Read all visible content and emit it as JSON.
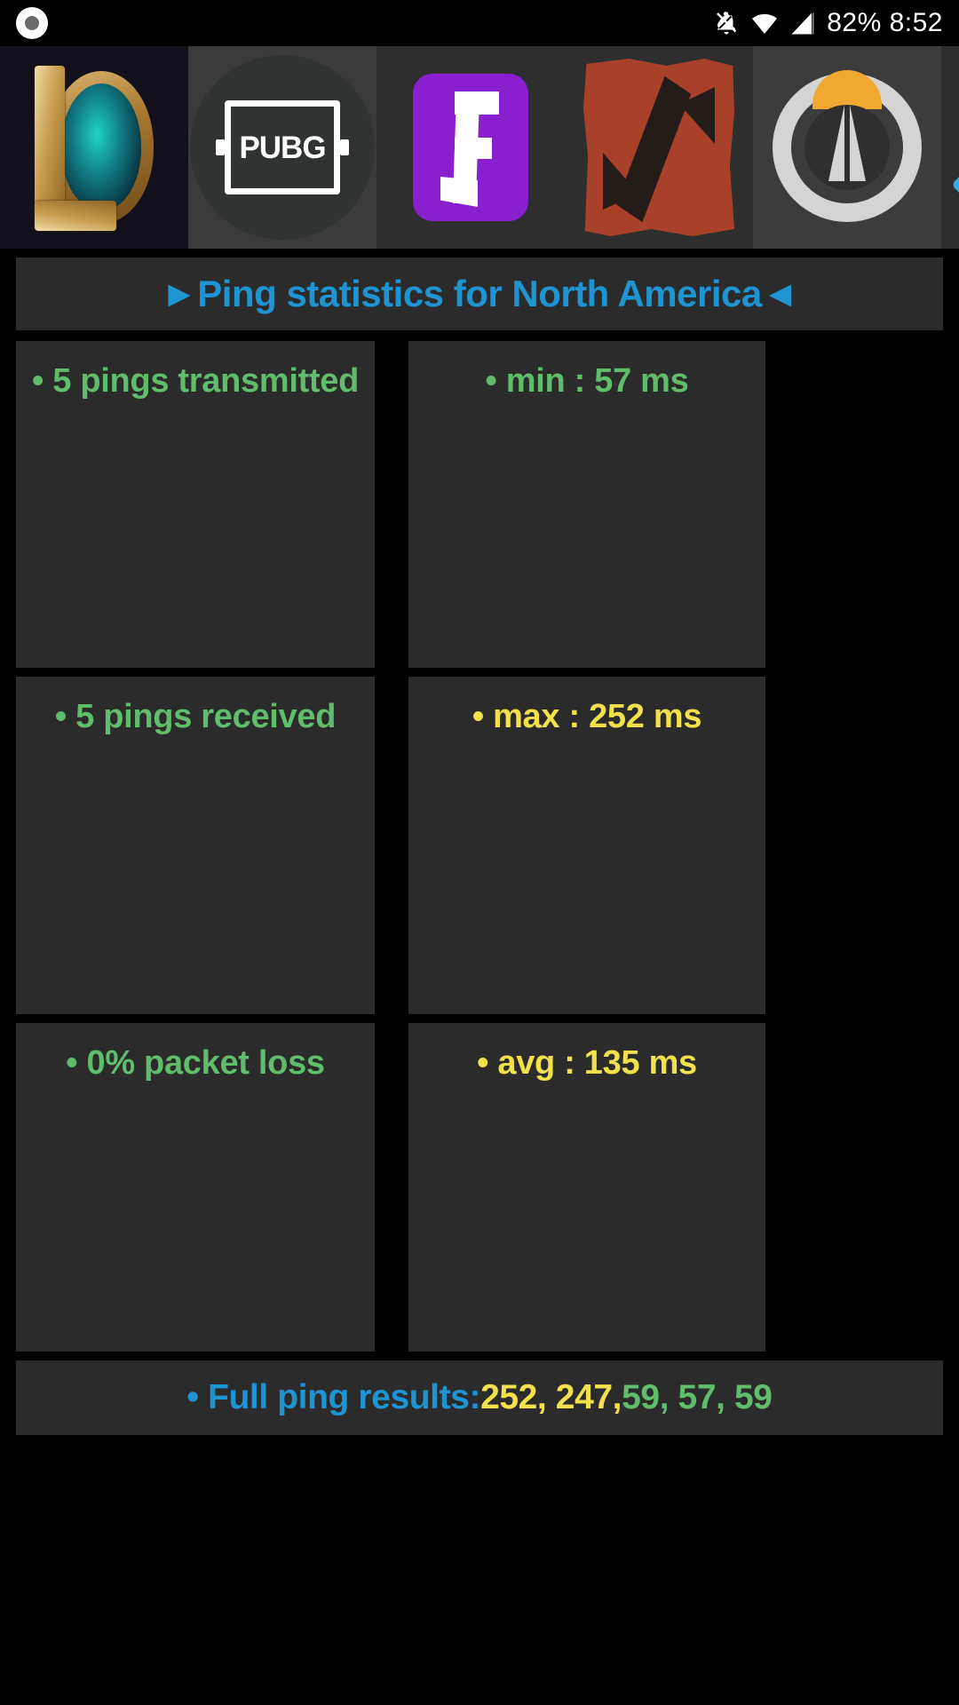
{
  "status_bar": {
    "recording_icon": "record-dot-icon",
    "notification_off_icon": "bell-off-icon",
    "wifi_icon": "wifi-icon",
    "signal_icon": "cellular-signal-icon",
    "battery_time": "82% 8:52"
  },
  "game_strip": {
    "items": [
      {
        "name": "league-of-legends",
        "label": "League of Legends"
      },
      {
        "name": "pubg",
        "label": "PUBG",
        "wordmark": "PUBG"
      },
      {
        "name": "fortnite",
        "label": "Fortnite"
      },
      {
        "name": "dota-2",
        "label": "Dota 2"
      },
      {
        "name": "overwatch",
        "label": "Overwatch"
      },
      {
        "name": "next-game-partial",
        "label": ""
      }
    ]
  },
  "title": {
    "text": "►Ping statistics for North America◄",
    "color": "#1e94d2"
  },
  "stats": {
    "rows": [
      {
        "left": {
          "text": "• 5 pings transmitted",
          "color": "#5fbd6b",
          "name": "stat-pings-transmitted"
        },
        "right": {
          "text": "• min : 57 ms",
          "color": "#5fbd6b",
          "name": "stat-min"
        }
      },
      {
        "left": {
          "text": "• 5 pings received",
          "color": "#5fbd6b",
          "name": "stat-pings-received"
        },
        "right": {
          "text": "• max : 252 ms",
          "color": "#f3e04d",
          "name": "stat-max"
        }
      },
      {
        "left": {
          "text": "• 0% packet loss",
          "color": "#5fbd6b",
          "name": "stat-packet-loss"
        },
        "right": {
          "text": "• avg : 135 ms",
          "color": "#f3e04d",
          "name": "stat-avg"
        }
      }
    ]
  },
  "footer": {
    "label": "• Full ping results: ",
    "high_values": "252, 247, ",
    "low_values": "59, 57, 59",
    "label_color": "#1e94d2",
    "high_color": "#f3e04d",
    "low_color": "#5fbd6b"
  },
  "chart_data": {
    "type": "table",
    "title": "Ping statistics for North America",
    "region": "North America",
    "pings_transmitted": 5,
    "pings_received": 5,
    "packet_loss_percent": 0,
    "min_ms": 57,
    "max_ms": 252,
    "avg_ms": 135,
    "unit": "ms",
    "samples": [
      252,
      247,
      59,
      57,
      59
    ]
  }
}
